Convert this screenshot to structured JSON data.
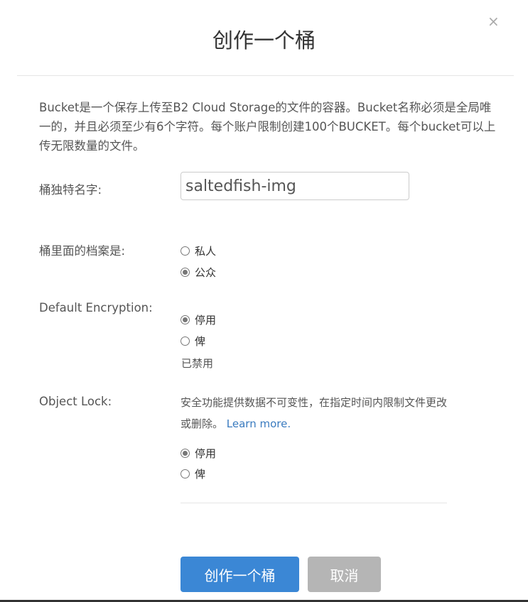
{
  "dialog": {
    "title": "创作一个桶",
    "close_glyph": "×",
    "description": "Bucket是一个保存上传至B2 Cloud Storage的文件的容器。Bucket名称必须是全局唯一的，并且必须至少有6个字符。每个账户限制创建100个BUCKET。每个bucket可以上传无限数量的文件。"
  },
  "bucket_name": {
    "label": "桶独特名字:",
    "value": "saltedfish-img"
  },
  "files_privacy": {
    "label": "桶里面的档案是:",
    "options": [
      "私人",
      "公众"
    ],
    "selected": "公众"
  },
  "encryption": {
    "label": "Default Encryption:",
    "options": [
      "停用",
      "俾"
    ],
    "selected": "停用",
    "status": "已禁用"
  },
  "object_lock": {
    "label": "Object Lock:",
    "description": "安全功能提供数据不可变性，在指定时间内限制文件更改或删除。",
    "link": "Learn more.",
    "options": [
      "停用",
      "俾"
    ],
    "selected": "停用"
  },
  "buttons": {
    "create": "创作一个桶",
    "cancel": "取消"
  },
  "colors": {
    "primary": "#3b87d5",
    "cancel": "#b5b5b5",
    "link": "#3a7bbf"
  }
}
